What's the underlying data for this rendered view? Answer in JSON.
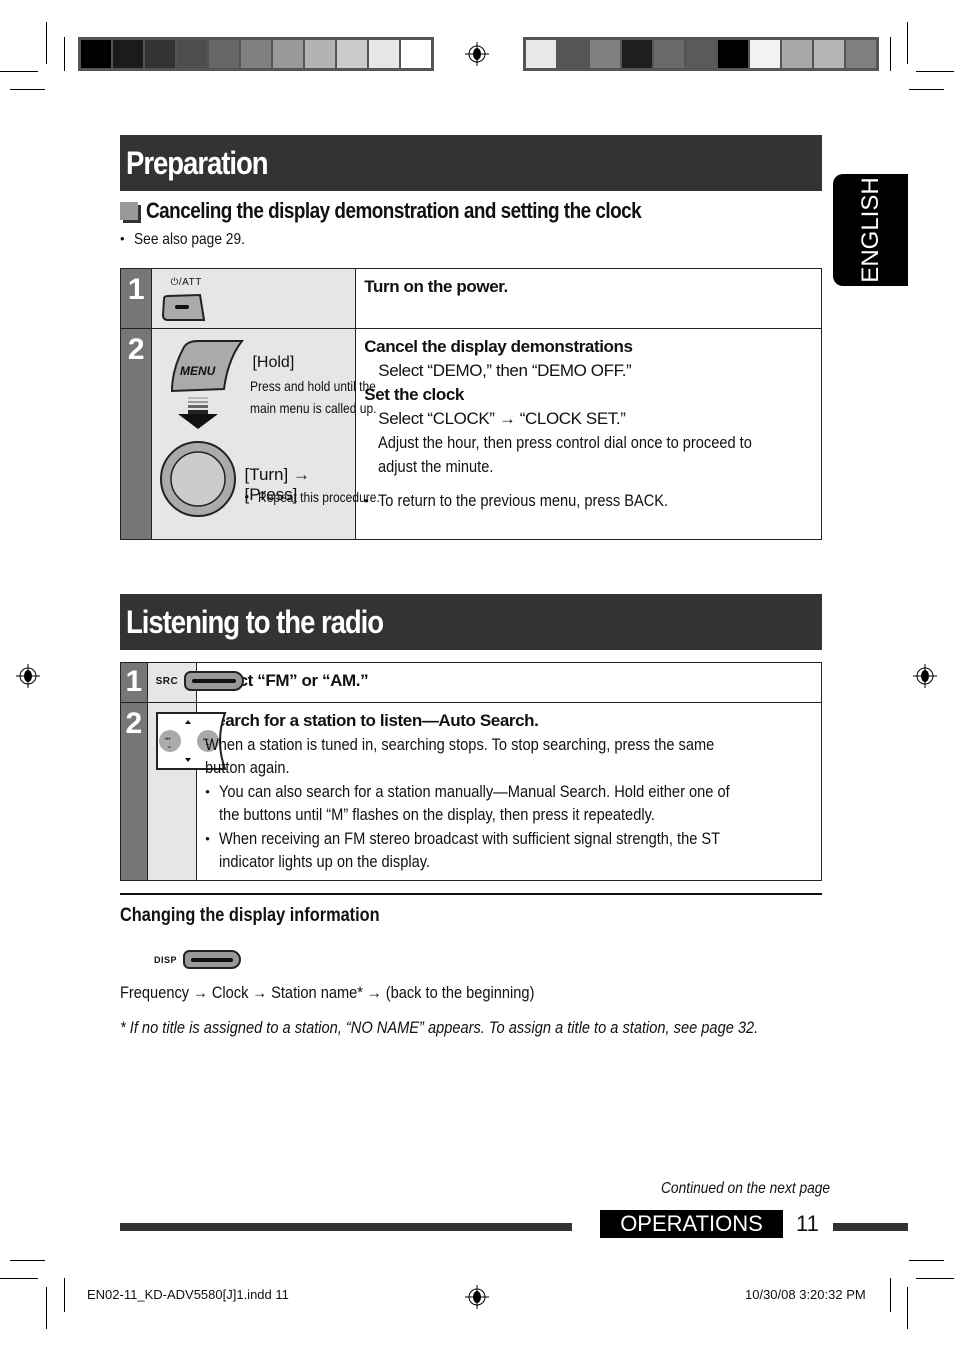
{
  "print_marks": {
    "color_bar_left": [
      "#000000",
      "#1b1b1b",
      "#333333",
      "#4d4d4d",
      "#666666",
      "#808080",
      "#999999",
      "#b3b3b3",
      "#cccccc",
      "#e6e6e6",
      "#ffffff"
    ],
    "color_bar_right": [
      "#e8e8e8",
      "#555555",
      "#808080",
      "#1e1e1e",
      "#6a6a6a",
      "#5a5a5a",
      "#000000",
      "#f2f2f2",
      "#a8a8a8",
      "#b5b5b5",
      "#7f7f7f"
    ]
  },
  "language_tab": "ENGLISH",
  "preparation": {
    "title": "Preparation",
    "subsection_title": "Canceling the display demonstration and setting the clock",
    "see_also": "See also page 29.",
    "steps": [
      {
        "number": "1",
        "button_label": "⏻/ATT",
        "heading": "Turn on the power."
      },
      {
        "number": "2",
        "menu_button_label": "MENU",
        "hold_label": "[Hold]",
        "hold_desc_1": "Press and hold until the",
        "hold_desc_2": "main menu is called up.",
        "turn_press": "[Turn] → [Press]",
        "repeat": "Repeat this procedure.",
        "heading_1": "Cancel the display demonstrations",
        "line_1": "Select “DEMO,” then “DEMO OFF.”",
        "heading_2": "Set the clock",
        "line_2": "Select “CLOCK” → “CLOCK SET.”",
        "line_3a": "Adjust the hour, then press control dial once to proceed to",
        "line_3b": "adjust the minute.",
        "bullet": "To return to the previous menu, press BACK."
      }
    ]
  },
  "radio": {
    "title": "Listening to the radio",
    "steps": [
      {
        "number": "1",
        "button_label": "SRC",
        "heading": "Select “FM” or “AM.”"
      },
      {
        "number": "2",
        "heading": "Search for a station to listen—Auto Search.",
        "para_1a": "When a station is tuned in, searching stops. To stop searching, press the same",
        "para_1b": "button again.",
        "bullet_1a": "You can also search for a station manually—Manual Search. Hold either one of",
        "bullet_1b": "the buttons until “M” flashes on the display, then press it repeatedly.",
        "bullet_2a": "When receiving an FM stereo broadcast with sufficient signal strength, the ST",
        "bullet_2b": "indicator lights up on the display."
      }
    ],
    "display_info": {
      "heading": "Changing the display information",
      "button_label": "DISP",
      "sequence": "Frequency → Clock → Station name* → (back to the beginning)",
      "footnote": "*  If no title is assigned to a station, “NO NAME” appears. To assign a title to a station, see page 32."
    }
  },
  "footer": {
    "continued": "Continued on the next page",
    "section": "OPERATIONS",
    "page_number": "11",
    "slug_file": "EN02-11_KD-ADV5580[J]1.indd   11",
    "slug_date": "10/30/08   3:20:32 PM"
  }
}
